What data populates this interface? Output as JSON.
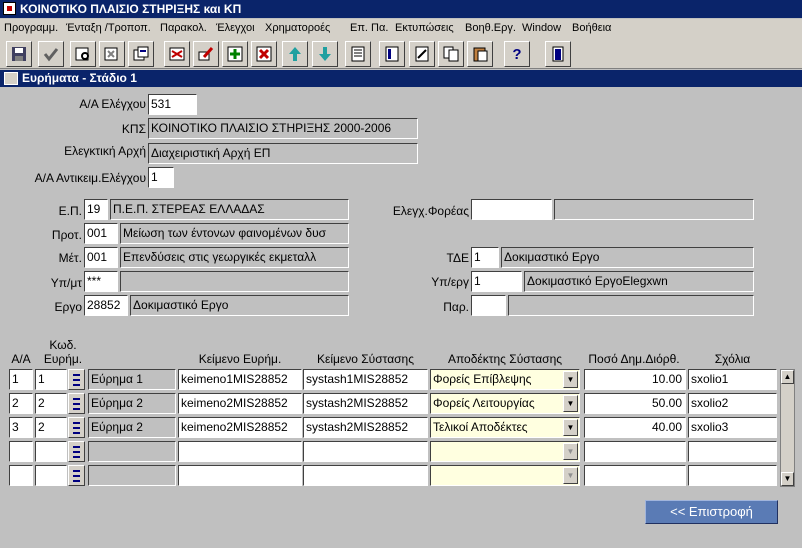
{
  "app": {
    "title": "ΚΟΙΝΟΤΙΚΟ ΠΛΑΙΣΙΟ ΣΤΗΡΙΞΗΣ και ΚΠ"
  },
  "menu": [
    "Προγραμμ.",
    "Ένταξη /Τροποπ.",
    "Παρακολ.",
    "Έλεγχοι",
    "Χρηματοροές",
    "Επ. Πα.",
    "Εκτυπώσεις",
    "Βοηθ.Εργ.",
    "Window",
    "Βοήθεια"
  ],
  "toolbar": {
    "buttons": [
      "save-icon",
      "accept-icon",
      "query-enter-icon",
      "query-cancel-icon",
      "query-execute-icon",
      "print-preview-icon",
      "edit-icon",
      "insert-record-icon",
      "delete-record-icon",
      "previous-record-icon",
      "next-record-icon",
      "list-icon",
      "field-list-icon",
      "edit-text-icon",
      "copy-icon",
      "paste-icon",
      "help-icon",
      "exit-icon"
    ]
  },
  "window": {
    "title": "Ευρήματα - Στάδιο 1"
  },
  "form": {
    "aa_elegxou_label": "Α/Α Ελέγχου",
    "aa_elegxou": "531",
    "kps_label": "ΚΠΣ",
    "kps": "ΚΟΙΝΟΤΙΚΟ ΠΛΑΙΣΙΟ ΣΤΗΡΙΞΗΣ 2000-2006",
    "arxi_label": "Ελεγκτική Αρχή",
    "arxi": "Διαχειριστική Αρχή ΕΠ",
    "aa_antikeim_label": "Α/Α Αντικειμ.Ελέγχου",
    "aa_antikeim": "1",
    "ep_label": "Ε.Π.",
    "ep_code": "19",
    "ep_name": "Π.Ε.Π. ΣΤΕΡΕΑΣ ΕΛΛΑΔΑΣ",
    "prot_label": "Προτ.",
    "prot_code": "001",
    "prot_name": "Μείωση των έντονων φαινομένων δυσ",
    "met_label": "Μέτ.",
    "met_code": "001",
    "met_name": "Επενδύσεις στις γεωργικές εκμεταλλ",
    "ypmt_label": "Υπ/μτ",
    "ypmt_code": "***",
    "ypmt_name": "",
    "ergo_label": "Εργο",
    "ergo_code": "28852",
    "ergo_name": "Δοκιμαστικό Εργο",
    "forea_label": "Ελεγχ.Φορέας",
    "forea_code": "",
    "forea_name": "",
    "tde_label": "ΤΔΕ",
    "tde_code": "1",
    "tde_name": "Δοκιμαστικό Εργο",
    "yperg_label": "Υπ/εργ",
    "yperg_code": "1",
    "yperg_name": "Δοκιμαστικό ΕργοElegxwn",
    "par_label": "Παρ.",
    "par_code": "",
    "par_name": ""
  },
  "table": {
    "headers": {
      "aa": "Α/Α",
      "kod": "Κωδ.",
      "kod2": "Ευρήμ.",
      "keimeno": "Κείμενο Ευρήμ.",
      "systasi": "Κείμενο Σύστασης",
      "apodektis": "Αποδέκτης Σύστασης",
      "poso": "Ποσό Δημ.Διόρθ.",
      "sxolia": "Σχόλια"
    },
    "rows": [
      {
        "aa": "1",
        "kod": "1",
        "eurima": "Εύρημα 1",
        "keimeno": "keimeno1MIS28852",
        "systasi": "systash1MIS28852",
        "apodektis": "Φορείς Επίβλεψης",
        "poso": "10.00",
        "sxolia": "sxolio1"
      },
      {
        "aa": "2",
        "kod": "2",
        "eurima": "Εύρημα 2",
        "keimeno": "keimeno2MIS28852",
        "systasi": "systash2MIS28852",
        "apodektis": "Φορείς Λειτουργίας",
        "poso": "50.00",
        "sxolia": "sxolio2"
      },
      {
        "aa": "3",
        "kod": "2",
        "eurima": "Εύρημα 2",
        "keimeno": "keimeno2MIS28852",
        "systasi": "systash2MIS28852",
        "apodektis": "Τελικοί Αποδέκτες",
        "poso": "40.00",
        "sxolia": "sxolio3"
      },
      {
        "aa": "",
        "kod": "",
        "eurima": "",
        "keimeno": "",
        "systasi": "",
        "apodektis": "",
        "poso": "",
        "sxolia": ""
      },
      {
        "aa": "",
        "kod": "",
        "eurima": "",
        "keimeno": "",
        "systasi": "",
        "apodektis": "",
        "poso": "",
        "sxolia": ""
      }
    ]
  },
  "return_button": "<< Επιστροφή"
}
